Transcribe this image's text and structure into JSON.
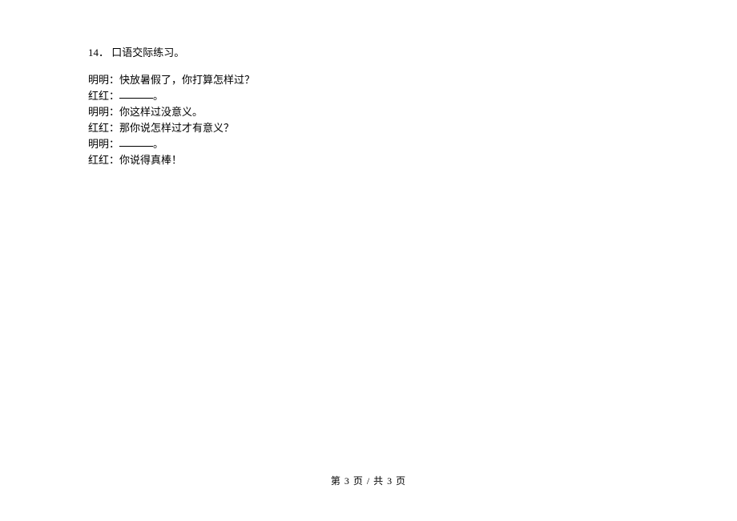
{
  "question": {
    "number": "14．",
    "title": "口语交际练习。"
  },
  "dialogue": [
    {
      "speaker": "明明：",
      "text_before": "快放暑假了，你打算怎样过？",
      "has_blank": false,
      "text_after": ""
    },
    {
      "speaker": "红红：",
      "text_before": "",
      "has_blank": true,
      "text_after": "。"
    },
    {
      "speaker": "明明：",
      "text_before": "你这样过没意义。",
      "has_blank": false,
      "text_after": ""
    },
    {
      "speaker": "红红：",
      "text_before": "那你说怎样过才有意义？",
      "has_blank": false,
      "text_after": ""
    },
    {
      "speaker": "明明：",
      "text_before": "",
      "has_blank": true,
      "text_after": "。"
    },
    {
      "speaker": "红红：",
      "text_before": "你说得真棒！",
      "has_blank": false,
      "text_after": ""
    }
  ],
  "footer": {
    "text": "第 3 页  /  共 3 页"
  }
}
